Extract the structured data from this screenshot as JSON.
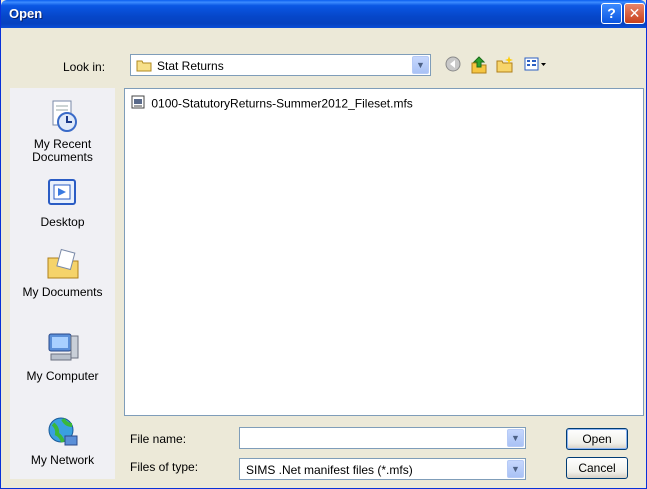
{
  "window": {
    "title": "Open",
    "help_label": "?",
    "close_label": "✕"
  },
  "lookin": {
    "label": "Look in:",
    "value": "Stat Returns"
  },
  "toolbar": {
    "icons": [
      "back-icon",
      "up-folder-icon",
      "new-folder-icon",
      "views-menu-icon"
    ]
  },
  "places": [
    {
      "label": "My Recent\nDocuments",
      "icon": "recent-documents-icon"
    },
    {
      "label": "Desktop",
      "icon": "desktop-icon"
    },
    {
      "label": "My Documents",
      "icon": "my-documents-icon"
    },
    {
      "label": "My Computer",
      "icon": "my-computer-icon"
    },
    {
      "label": "My Network",
      "icon": "my-network-icon"
    }
  ],
  "files": [
    {
      "name": "0100-StatutoryReturns-Summer2012_Fileset.mfs",
      "icon": "mfs-file-icon"
    }
  ],
  "filename": {
    "label": "File name:",
    "value": ""
  },
  "filetype": {
    "label": "Files of type:",
    "value": "SIMS .Net manifest files (*.mfs)"
  },
  "buttons": {
    "open": "Open",
    "cancel": "Cancel"
  },
  "colors": {
    "titlebar": "#0a57e4",
    "dialog_bg": "#ece9d8",
    "field_border": "#7f9db9"
  }
}
